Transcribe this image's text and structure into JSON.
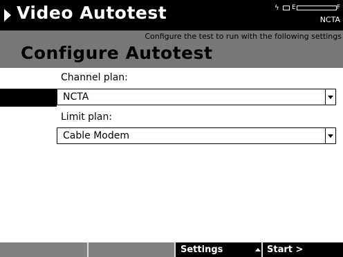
{
  "title_bar": {
    "title": "Video Autotest",
    "status_icons": [
      "power-bolt-icon",
      "plug-icon",
      "battery-gauge-icon"
    ],
    "battery_empty_label": "E",
    "battery_full_label": "F",
    "active_plan": "NCTA"
  },
  "header": {
    "subtitle": "Configure the test to run with the following settings",
    "page_title": "Configure Autotest"
  },
  "form": {
    "channel_plan": {
      "label": "Channel plan:",
      "value": "NCTA"
    },
    "limit_plan": {
      "label": "Limit plan:",
      "value": "Cable Modem"
    }
  },
  "softkeys": [
    {
      "label": ""
    },
    {
      "label": ""
    },
    {
      "label": "Settings"
    },
    {
      "label": "Start >"
    }
  ]
}
